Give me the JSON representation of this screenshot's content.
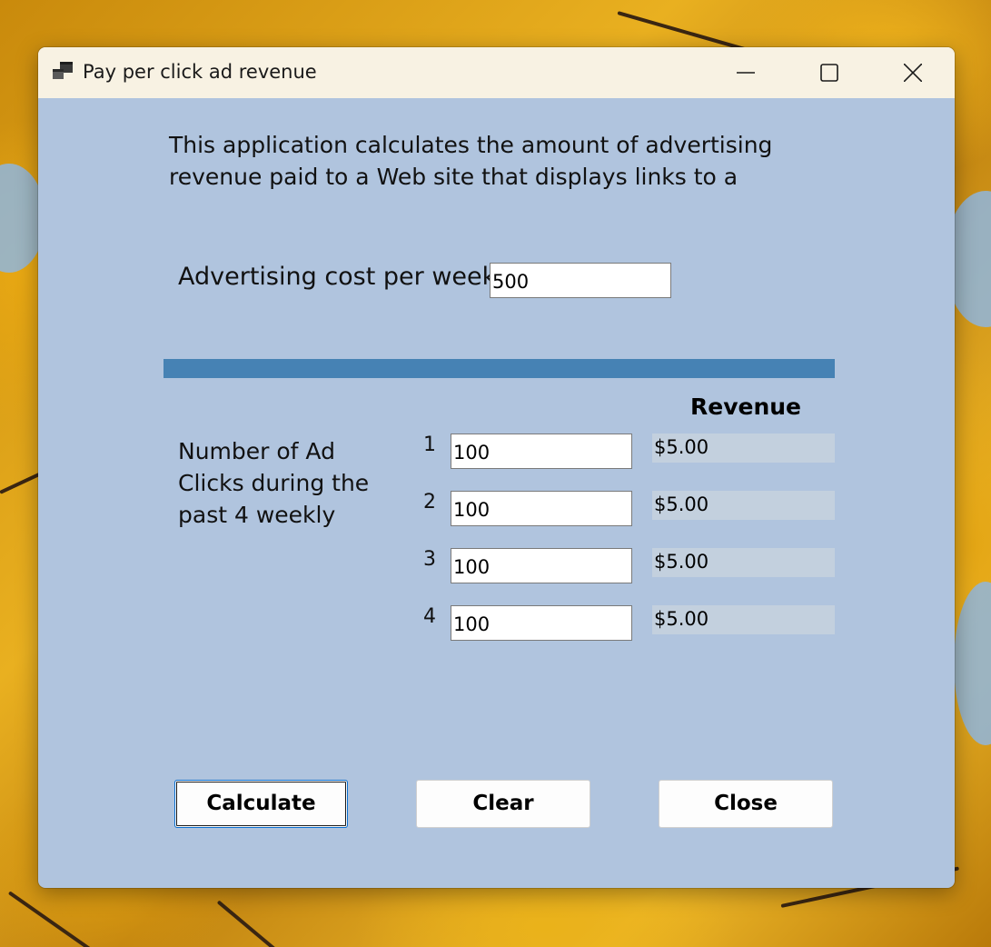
{
  "window": {
    "title": "Pay per click ad revenue",
    "caption_buttons": [
      "minimize-icon",
      "maximize-icon",
      "close-icon"
    ]
  },
  "intro_text": "This application calculates the amount of advertising revenue paid to a Web site that displays links to a",
  "cost": {
    "label": "Advertising cost per week:",
    "value": "500"
  },
  "clicks": {
    "label": "Number of Ad Clicks during the past 4 weekly",
    "revenue_header": "Revenue",
    "rows": [
      {
        "number": "1",
        "clicks": "100",
        "revenue": "$5.00"
      },
      {
        "number": "2",
        "clicks": "100",
        "revenue": "$5.00"
      },
      {
        "number": "3",
        "clicks": "100",
        "revenue": "$5.00"
      },
      {
        "number": "4",
        "clicks": "100",
        "revenue": "$5.00"
      }
    ]
  },
  "buttons": {
    "calculate": "Calculate",
    "clear": "Clear",
    "close": "Close"
  },
  "colors": {
    "form_background": "#b0c4de",
    "title_bar": "#f8f2e3",
    "divider": "#4682b4",
    "output_background": "#c3d0de",
    "focus_border": "#0b6fcf"
  }
}
